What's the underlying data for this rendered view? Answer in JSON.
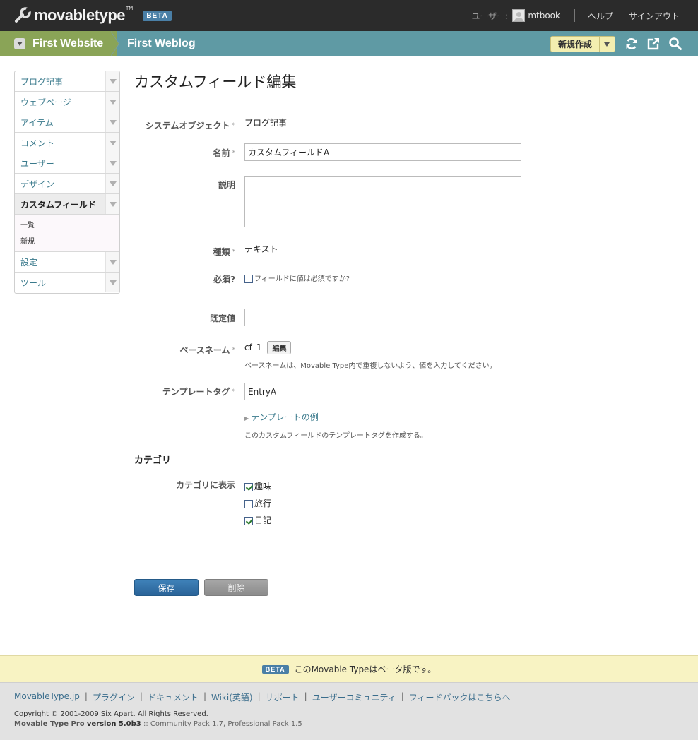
{
  "header": {
    "logo_text": "movabletype",
    "logo_tm": "TM",
    "beta_badge": "BETA",
    "user_label": "ユーザー:",
    "username": "mtbook",
    "help": "ヘルプ",
    "signout": "サインアウト"
  },
  "nav": {
    "website": "First Website",
    "blog": "First Weblog",
    "new_button": "新規作成"
  },
  "sidebar": {
    "items": [
      {
        "label": "ブログ記事"
      },
      {
        "label": "ウェブページ"
      },
      {
        "label": "アイテム"
      },
      {
        "label": "コメント"
      },
      {
        "label": "ユーザー"
      },
      {
        "label": "デザイン"
      },
      {
        "label": "カスタムフィールド"
      },
      {
        "label": "設定"
      },
      {
        "label": "ツール"
      }
    ],
    "subitems": [
      "一覧",
      "新規"
    ]
  },
  "main": {
    "title": "カスタムフィールド編集",
    "fields": {
      "system_object": {
        "label": "システムオブジェクト",
        "value": "ブログ記事"
      },
      "name": {
        "label": "名前",
        "value": "カスタムフィールドA"
      },
      "description": {
        "label": "説明",
        "value": ""
      },
      "type": {
        "label": "種類",
        "value": "テキスト"
      },
      "required": {
        "label": "必須?",
        "checkbox_label": "フィールドに値は必須ですか?",
        "checked": false
      },
      "default": {
        "label": "既定値",
        "value": ""
      },
      "basename": {
        "label": "ベースネーム",
        "value": "cf_1",
        "edit_button": "編集",
        "hint": "ベースネームは、Movable Type内で重複しないよう、値を入力してください。"
      },
      "template_tag": {
        "label": "テンプレートタグ",
        "value": "EntryA",
        "examples_link": "テンプレートの例",
        "hint": "このカスタムフィールドのテンプレートタグを作成する。"
      }
    },
    "category_section": {
      "title": "カテゴリ",
      "label": "カテゴリに表示",
      "options": [
        {
          "label": "趣味",
          "checked": true
        },
        {
          "label": "旅行",
          "checked": false
        },
        {
          "label": "日記",
          "checked": true
        }
      ]
    },
    "buttons": {
      "save": "保存",
      "delete": "削除"
    },
    "required_mark": "*"
  },
  "footer": {
    "beta_badge": "BETA",
    "beta_notice": "このMovable Typeはベータ版です。",
    "links": [
      "MovableType.jp",
      "プラグイン",
      "ドキュメント",
      "Wiki(英語)",
      "サポート",
      "ユーザーコミュニティ",
      "フィードバックはこちらへ"
    ],
    "copyright": "Copyright © 2001-2009 Six Apart. All Rights Reserved.",
    "version_product": "Movable Type Pro",
    "version_label": "version 5.0b3",
    "version_rest": ":: Community Pack 1.7, Professional Pack 1.5"
  },
  "colors": {
    "topbar": "#2b2b2b",
    "navbar": "#5f9aa4",
    "website_tab": "#8aa457",
    "save_button": "#2a6398",
    "beta_bar": "#f8f3c3"
  }
}
